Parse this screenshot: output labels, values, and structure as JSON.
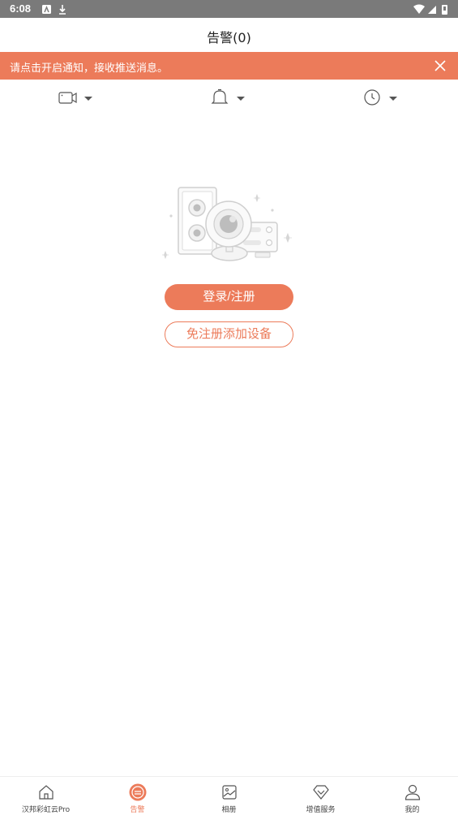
{
  "status_bar": {
    "time": "6:08"
  },
  "header": {
    "title": "告警(0)"
  },
  "notice": {
    "text": "请点击开启通知，接收推送消息。"
  },
  "filters": [
    {
      "icon": "camera-icon"
    },
    {
      "icon": "bell-icon"
    },
    {
      "icon": "clock-icon"
    }
  ],
  "actions": {
    "login_label": "登录/注册",
    "add_device_label": "免注册添加设备"
  },
  "tabs": [
    {
      "label": "汉邦彩虹云Pro",
      "icon": "home-icon"
    },
    {
      "label": "告警",
      "icon": "alarm-icon",
      "active": true
    },
    {
      "label": "相册",
      "icon": "album-icon"
    },
    {
      "label": "增值服务",
      "icon": "diamond-icon"
    },
    {
      "label": "我的",
      "icon": "person-icon"
    }
  ],
  "colors": {
    "accent": "#ec7b5a",
    "status_bar": "#7a7a7a"
  }
}
